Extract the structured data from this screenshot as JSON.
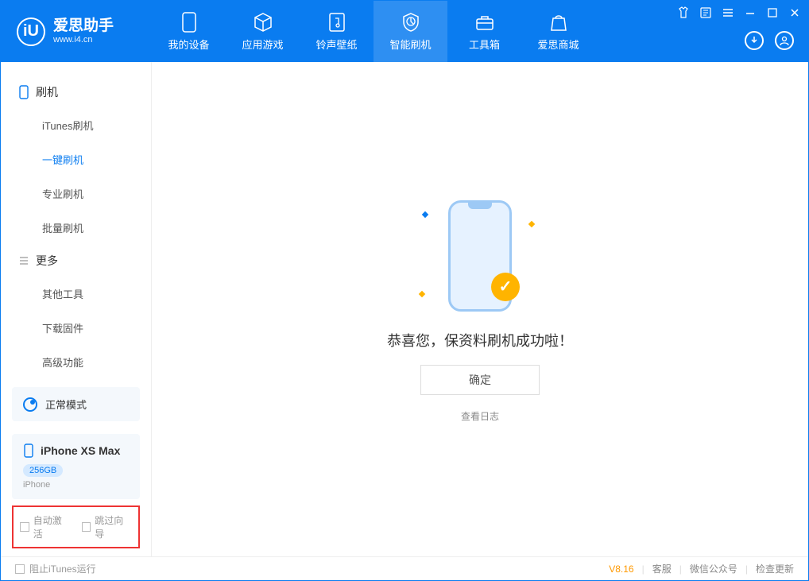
{
  "app": {
    "title": "爱思助手",
    "url": "www.i4.cn"
  },
  "tabs": {
    "my_device": "我的设备",
    "app_games": "应用游戏",
    "ringtone_wallpaper": "铃声壁纸",
    "smart_flash": "智能刷机",
    "toolbox": "工具箱",
    "store": "爱思商城"
  },
  "sidebar": {
    "group_flash": "刷机",
    "itunes_flash": "iTunes刷机",
    "onekey_flash": "一键刷机",
    "pro_flash": "专业刷机",
    "batch_flash": "批量刷机",
    "group_more": "更多",
    "other_tools": "其他工具",
    "download_firmware": "下载固件",
    "advanced": "高级功能"
  },
  "mode": {
    "label": "正常模式"
  },
  "device": {
    "name": "iPhone XS Max",
    "storage": "256GB",
    "type": "iPhone"
  },
  "checks": {
    "auto_activate": "自动激活",
    "skip_wizard": "跳过向导"
  },
  "main": {
    "success_text": "恭喜您，保资料刷机成功啦！",
    "confirm": "确定",
    "view_log": "查看日志"
  },
  "footer": {
    "block_itunes": "阻止iTunes运行",
    "version": "V8.16",
    "service": "客服",
    "wechat": "微信公众号",
    "check_update": "检查更新"
  }
}
